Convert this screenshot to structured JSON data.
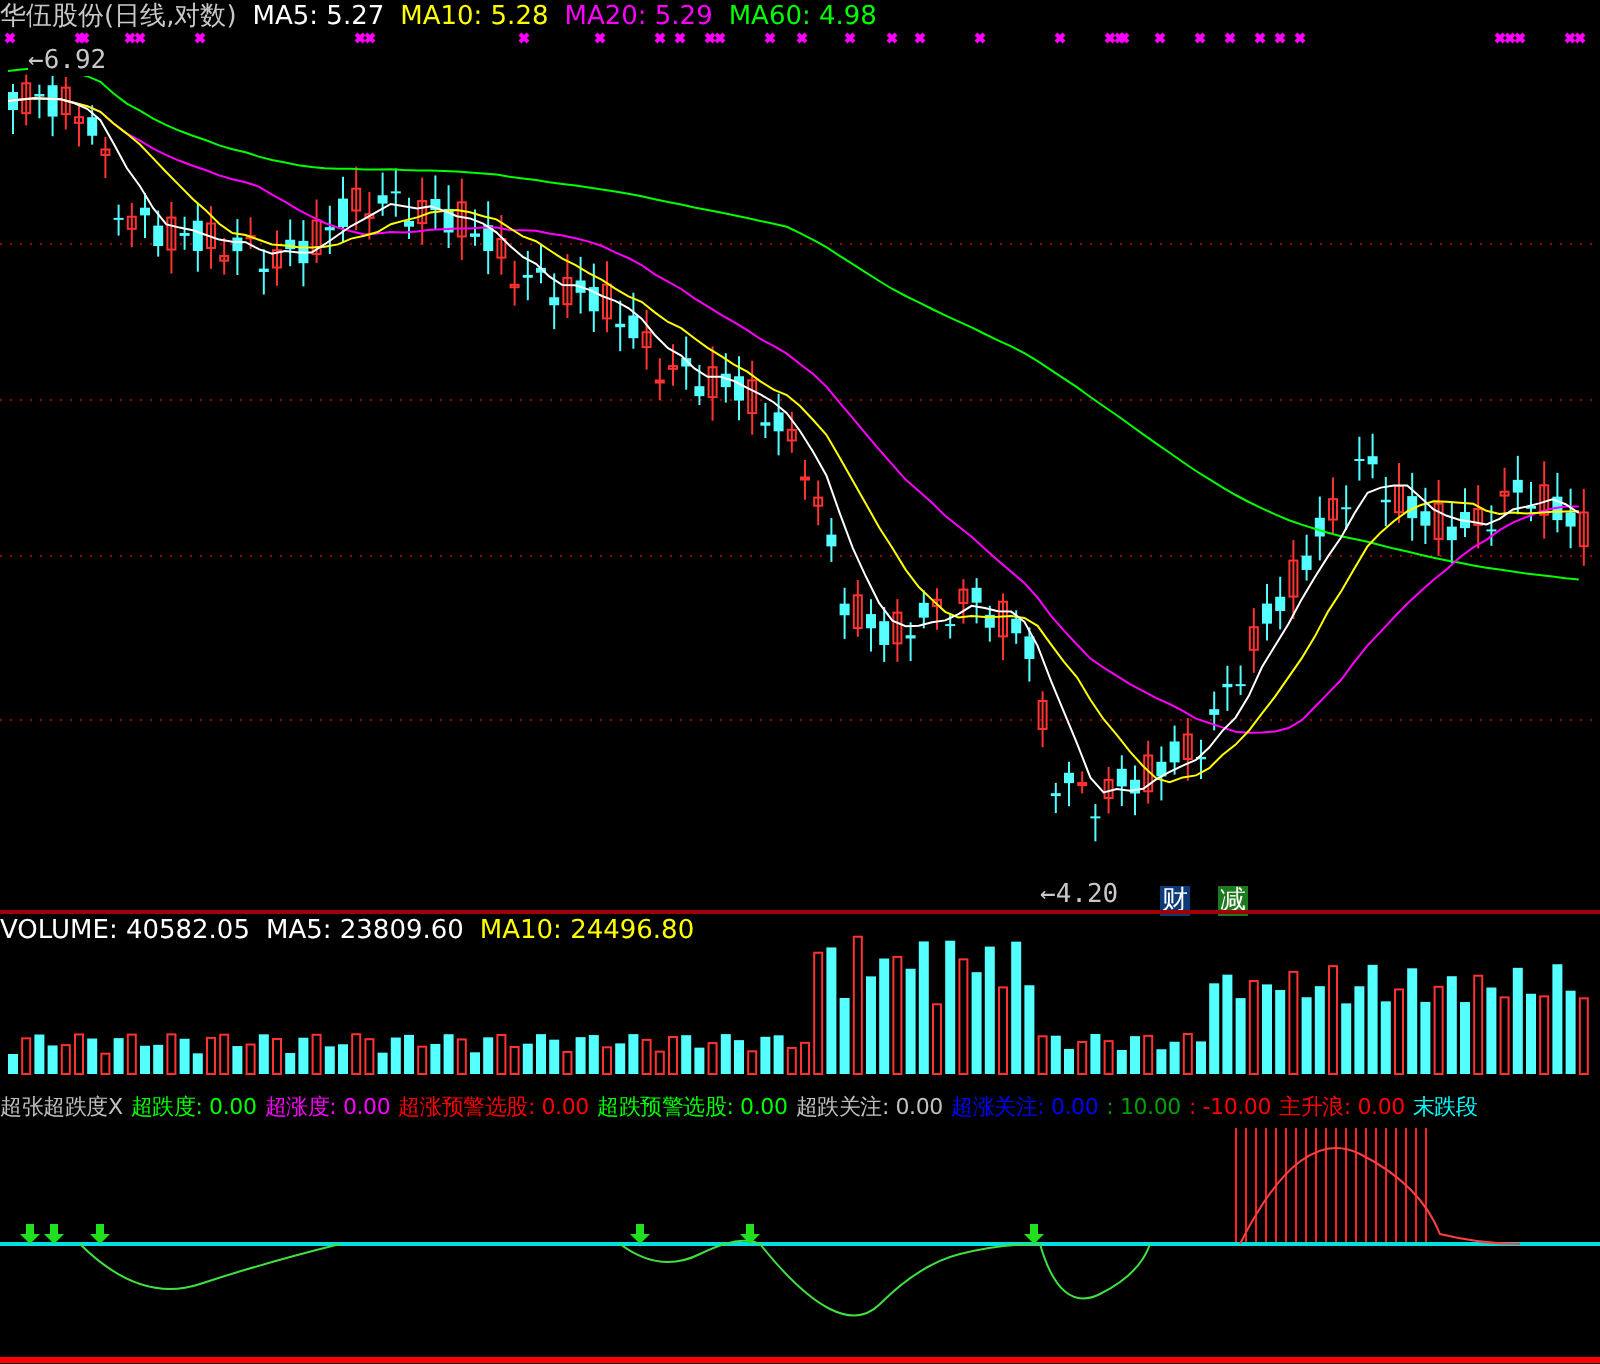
{
  "price_panel": {
    "title": "华伍股份(日线,对数)",
    "legend": [
      {
        "text": "MA5: 5.27",
        "color": "#ffffff"
      },
      {
        "text": "MA10: 5.28",
        "color": "#ffff00"
      },
      {
        "text": "MA20: 5.29",
        "color": "#ff00ff"
      },
      {
        "text": "MA60: 4.98",
        "color": "#00ff00"
      }
    ],
    "high_label": "←6.92",
    "low_label": "←4.20",
    "badges": [
      {
        "text": "财",
        "color": "#0a3a78"
      },
      {
        "text": "减",
        "color": "#1e7a1e"
      }
    ]
  },
  "volume_panel": {
    "legend": [
      {
        "text": "VOLUME: 40582.05",
        "color": "#ffffff"
      },
      {
        "text": "MA5: 23809.60",
        "color": "#ffffff"
      },
      {
        "text": "MA10: 24496.80",
        "color": "#ffff00"
      }
    ]
  },
  "indicator_panel": {
    "legend": [
      {
        "text": "超张超跌度X",
        "color": "#c0c0c0"
      },
      {
        "text": "超跌度: 0.00",
        "color": "#00ff00"
      },
      {
        "text": "超涨度: 0.00",
        "color": "#ff00ff"
      },
      {
        "text": "超涨预警选股: 0.00",
        "color": "#ff0000"
      },
      {
        "text": "超跌预警选股: 0.00",
        "color": "#00ff00"
      },
      {
        "text": "超跌关注: 0.00",
        "color": "#c0c0c0"
      },
      {
        "text": "超涨关注: 0.00",
        "color": "#0000ff"
      },
      {
        "text": ": 10.00",
        "color": "#00a000"
      },
      {
        "text": ": -10.00",
        "color": "#ff0000"
      },
      {
        "text": "主升浪: 0.00",
        "color": "#ff0000"
      },
      {
        "text": "末跌段",
        "color": "#00ffff"
      }
    ]
  }
}
